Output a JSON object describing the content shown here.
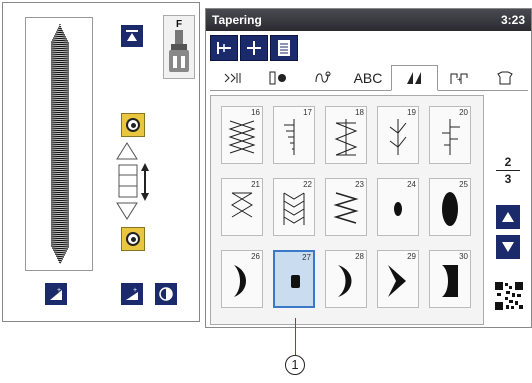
{
  "header": {
    "title": "Tapering",
    "time": "3:23"
  },
  "presser_foot": {
    "letter": "F"
  },
  "categories": [
    {
      "label": "",
      "icon": "utility-stitch-icon"
    },
    {
      "label": "",
      "icon": "buttonhole-icon"
    },
    {
      "label": "",
      "icon": "decorative-stitch-icon"
    },
    {
      "label": "ABC",
      "icon": ""
    },
    {
      "label": "",
      "icon": "tapering-icon",
      "active": true
    },
    {
      "label": "",
      "icon": "combination-icon"
    },
    {
      "label": "",
      "icon": "memory-icon"
    }
  ],
  "stitches": [
    {
      "num": "16"
    },
    {
      "num": "17"
    },
    {
      "num": "18"
    },
    {
      "num": "19"
    },
    {
      "num": "20"
    },
    {
      "num": "21"
    },
    {
      "num": "22"
    },
    {
      "num": "23"
    },
    {
      "num": "24"
    },
    {
      "num": "25"
    },
    {
      "num": "26"
    },
    {
      "num": "27",
      "selected": true
    },
    {
      "num": "28"
    },
    {
      "num": "29"
    },
    {
      "num": "30"
    }
  ],
  "page_indicator": {
    "current": "2",
    "total": "3"
  },
  "callout": {
    "label": "1"
  },
  "colors": {
    "accent": "#1b2a6b",
    "selected": "#c9dcf0",
    "callout": "#d61f1f"
  }
}
